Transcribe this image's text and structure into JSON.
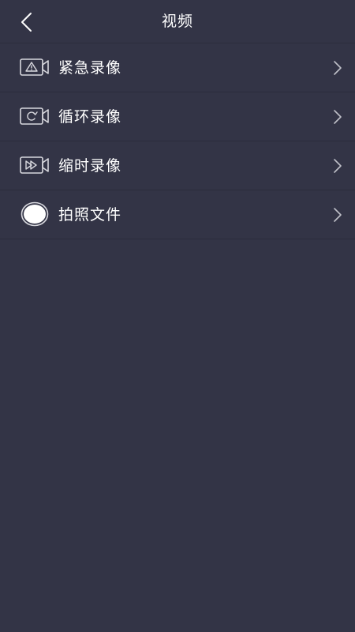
{
  "header": {
    "title": "视频",
    "back_icon": "chevron-left-icon"
  },
  "menu": {
    "items": [
      {
        "label": "紧急录像",
        "icon": "emergency-camera-icon"
      },
      {
        "label": "循环录像",
        "icon": "loop-camera-icon"
      },
      {
        "label": "缩时录像",
        "icon": "timelapse-camera-icon"
      },
      {
        "label": "拍照文件",
        "icon": "photo-circle-icon"
      }
    ],
    "chevron_icon": "chevron-right-icon"
  },
  "colors": {
    "background": "#333446",
    "divider": "#2b2c3c",
    "text": "#ffffff",
    "icon": "#d8d8de"
  }
}
